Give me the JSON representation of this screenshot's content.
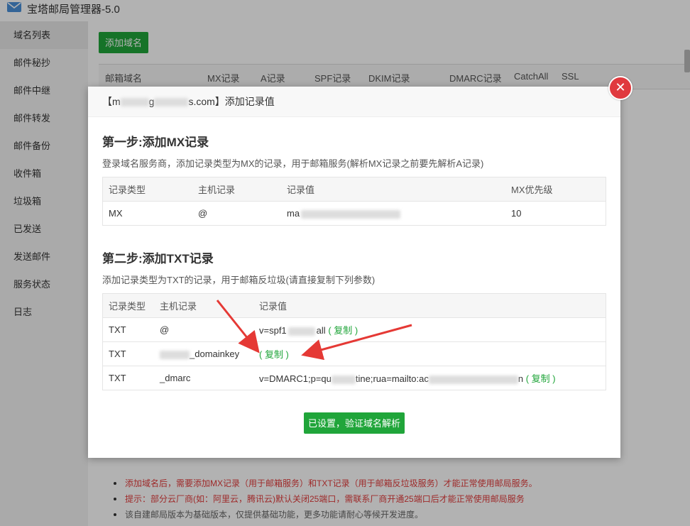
{
  "app": {
    "title": "宝塔邮局管理器-5.0"
  },
  "sidebar": {
    "items": [
      {
        "label": "域名列表"
      },
      {
        "label": "邮件秘抄"
      },
      {
        "label": "邮件中继"
      },
      {
        "label": "邮件转发"
      },
      {
        "label": "邮件备份"
      },
      {
        "label": "收件箱"
      },
      {
        "label": "垃圾箱"
      },
      {
        "label": "已发送"
      },
      {
        "label": "发送邮件"
      },
      {
        "label": "服务状态"
      },
      {
        "label": "日志"
      }
    ]
  },
  "main": {
    "add_domain_label": "添加域名",
    "table_headers": [
      "邮箱域名",
      "MX记录",
      "A记录",
      "SPF记录",
      "DKIM记录",
      "DMARC记录",
      "CatchAll",
      "SSL"
    ],
    "tips": [
      "添加域名后，需要添加MX记录（用于邮箱服务）和TXT记录（用于邮箱反垃圾服务）才能正常使用邮局服务。",
      "提示：部分云厂商(如：阿里云，腾讯云)默认关闭25端口，需联系厂商开通25端口后才能正常使用邮局服务",
      "该自建邮局版本为基础版本，仅提供基础功能，更多功能请耐心等候开发进度。"
    ]
  },
  "modal": {
    "title_prefix": "【m",
    "title_mid": "g",
    "title_suffix": "s.com】添加记录值",
    "close_symbol": "✕",
    "step1": {
      "title": "第一步:添加MX记录",
      "desc": "登录域名服务商，添加记录类型为MX的记录，用于邮箱服务(解析MX记录之前要先解析A记录)",
      "headers": [
        "记录类型",
        "主机记录",
        "记录值",
        "MX优先级"
      ],
      "row": {
        "type": "MX",
        "host": "@",
        "value": "ma",
        "priority": "10"
      }
    },
    "step2": {
      "title": "第二步:添加TXT记录",
      "desc": "添加记录类型为TXT的记录，用于邮箱反垃圾(请直接复制下列参数)",
      "headers": [
        "记录类型",
        "主机记录",
        "记录值"
      ],
      "rows": [
        {
          "type": "TXT",
          "host": "@",
          "value_start": "v=spf1",
          "value_end": "all",
          "copy": "( 复制 )"
        },
        {
          "type": "TXT",
          "host": "_domainkey",
          "value_start": "",
          "value_end": "",
          "copy": "( 复制 )"
        },
        {
          "type": "TXT",
          "host": "_dmarc",
          "value_start": "v=DMARC1;p=qu",
          "value_end": "tine;rua=mailto:ac",
          "value_tail": "n",
          "copy": "( 复制 )"
        }
      ]
    },
    "verify_label": "已设置，验证域名解析"
  },
  "colors": {
    "accent": "#20a53a",
    "danger": "#e0393e",
    "tip_red": "#e23c3c"
  }
}
